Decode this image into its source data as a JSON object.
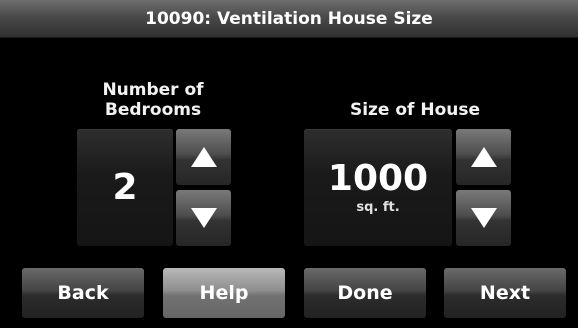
{
  "title": "10090: Ventilation House Size",
  "bedrooms": {
    "label_line1": "Number of",
    "label_line2": "Bedrooms",
    "value": "2",
    "up_icon": "arrow-up-icon",
    "down_icon": "arrow-down-icon"
  },
  "house_size": {
    "label": "Size of House",
    "value": "1000",
    "unit": "sq. ft.",
    "up_icon": "arrow-up-icon",
    "down_icon": "arrow-down-icon"
  },
  "buttons": {
    "back": "Back",
    "help": "Help",
    "done": "Done",
    "next": "Next"
  }
}
